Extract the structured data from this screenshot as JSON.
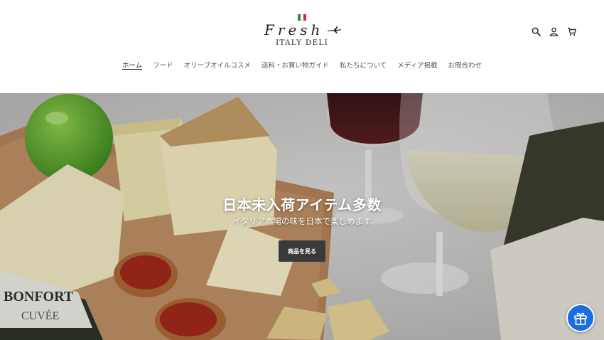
{
  "header": {
    "logo_script": "Fresh",
    "logo_sub": "ITALY DELI",
    "icons": [
      "search-icon",
      "account-icon",
      "cart-icon"
    ]
  },
  "nav": {
    "items": [
      {
        "label": "ホーム",
        "active": true
      },
      {
        "label": "フード",
        "active": false
      },
      {
        "label": "オリーブオイルコスメ",
        "active": false
      },
      {
        "label": "送料・お買い物ガイド",
        "active": false
      },
      {
        "label": "私たちについて",
        "active": false
      },
      {
        "label": "メディア掲載",
        "active": false
      },
      {
        "label": "お問合わせ",
        "active": false
      }
    ]
  },
  "hero": {
    "title": "日本未入荷アイテム多数",
    "subtitle": "イタリア本場の味を日本で楽しめます",
    "button_label": "商品を見る",
    "bottle_label": "BONFORT",
    "bottle_label2": "CUVÉE"
  },
  "colors": {
    "accent_button": "#3a3a3a",
    "gift_button": "#1b6fe0",
    "flag_green": "#2e8b3e",
    "flag_white": "#ffffff",
    "flag_red": "#d1263a"
  }
}
